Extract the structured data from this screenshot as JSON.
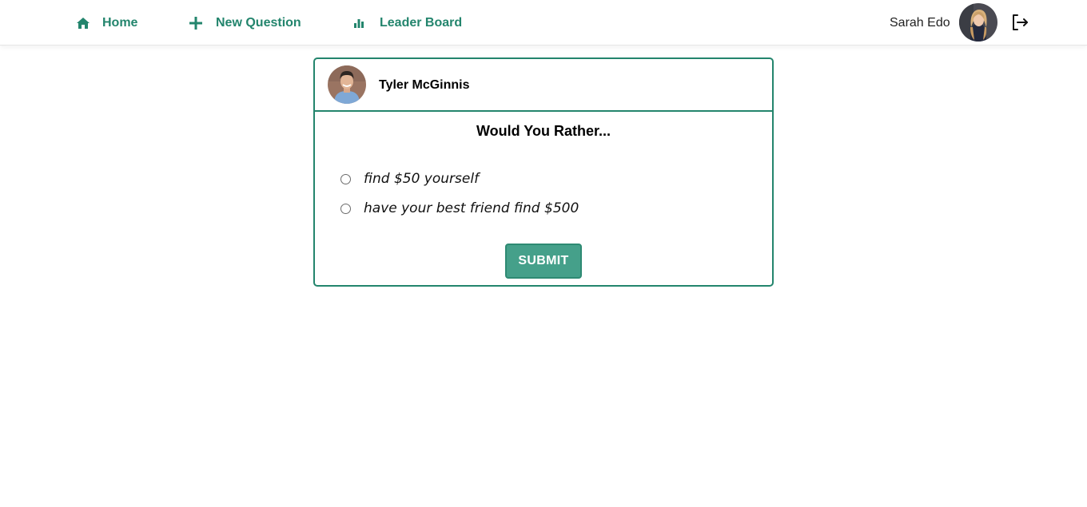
{
  "nav": {
    "home_label": "Home",
    "new_question_label": "New Question",
    "leader_board_label": "Leader Board",
    "home_icon": "home-icon",
    "new_question_icon": "plus-icon",
    "leader_board_icon": "bar-chart-icon"
  },
  "user": {
    "name": "Sarah Edo",
    "logout_icon": "logout-icon"
  },
  "question": {
    "author": "Tyler McGinnis",
    "title": "Would You Rather...",
    "options": [
      {
        "text": "find $50 yourself"
      },
      {
        "text": "have your best friend find $500"
      }
    ],
    "submit_label": "SUBMIT"
  },
  "colors": {
    "accent": "#23856d",
    "button": "#45a08a"
  }
}
